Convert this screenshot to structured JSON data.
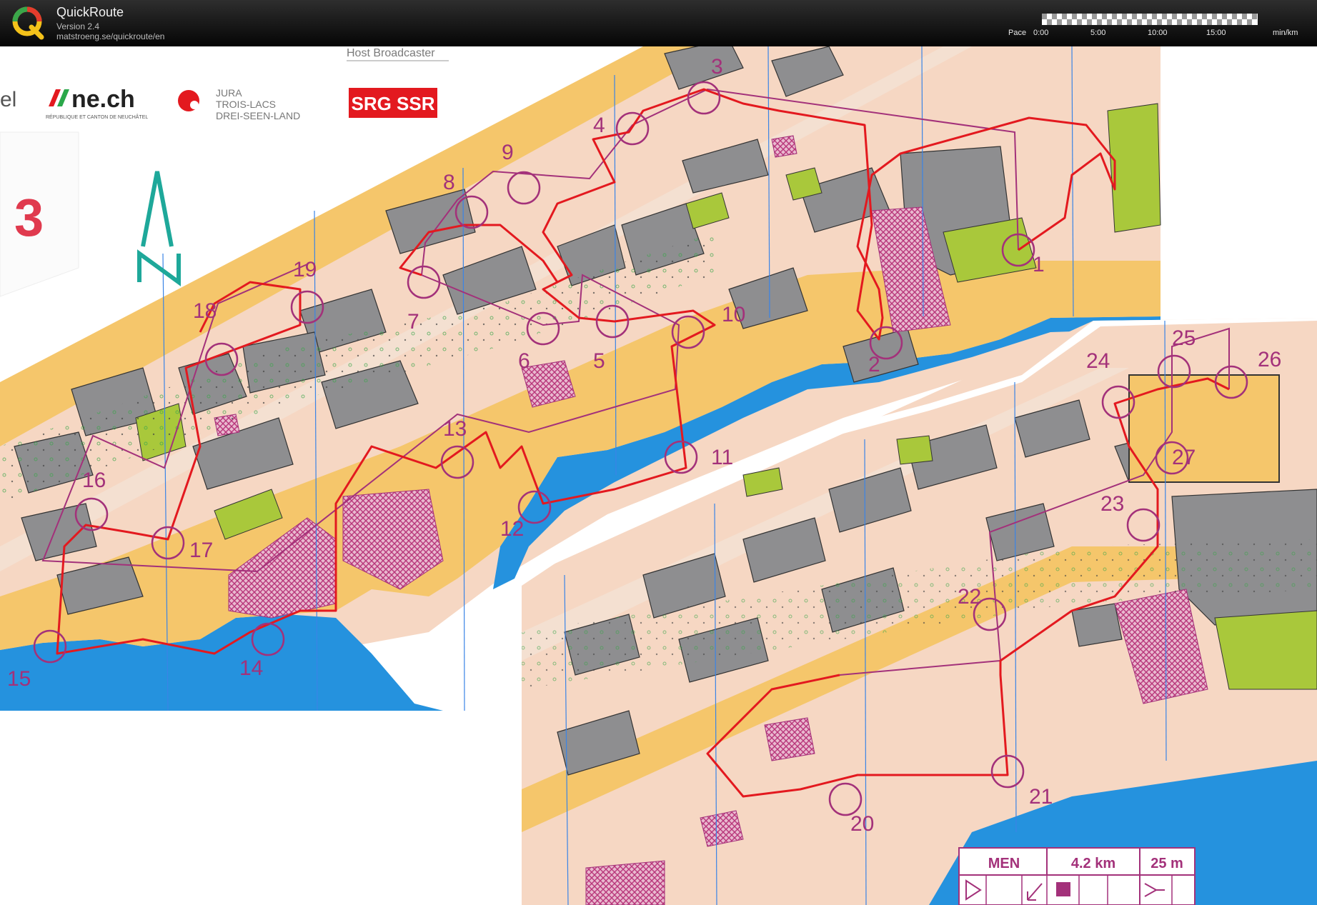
{
  "app": {
    "name": "QuickRoute",
    "version": "Version 2.4",
    "url": "matstroeng.se/quickroute/en"
  },
  "pace_scale": {
    "label": "Pace",
    "ticks": [
      "0:00",
      "5:00",
      "10:00",
      "15:00"
    ],
    "unit": "min/km"
  },
  "map": {
    "map_number": "3",
    "host_label": "Host Broadcaster",
    "sponsors": {
      "ne_logo": "ne.ch",
      "ne_caption": "RÉPUBLIQUE ET CANTON DE NEUCHÂTEL",
      "jura_line1": "JURA",
      "jura_line2": "TROIS-LACS",
      "jura_line3": "DREI-SEEN-LAND",
      "srg": "SRG SSR",
      "cut_word": "el"
    },
    "controls": [
      "1",
      "2",
      "3",
      "4",
      "5",
      "6",
      "7",
      "8",
      "9",
      "10",
      "11",
      "12",
      "13",
      "14",
      "15",
      "16",
      "17",
      "18",
      "19",
      "20",
      "21",
      "22",
      "23",
      "24",
      "25",
      "26",
      "27"
    ],
    "course_box": {
      "class": "MEN",
      "distance": "4.2 km",
      "climb": "25 m"
    },
    "colors": {
      "route": "#e3191f",
      "course": "#a3317a",
      "water": "#2592de",
      "paved": "#f5c66b",
      "building": "#8e8e90",
      "vegetation": "#a9c83b",
      "outofbounds": "#c5508b"
    }
  }
}
